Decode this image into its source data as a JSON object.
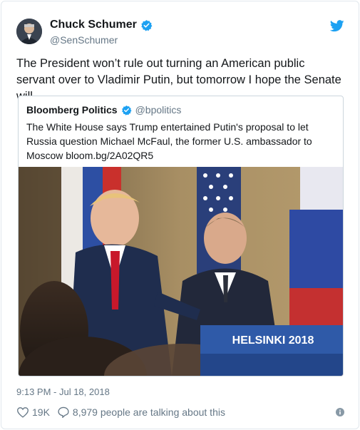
{
  "author": {
    "name": "Chuck Schumer",
    "handle": "@SenSchumer",
    "verified_icon": "verified-badge-icon"
  },
  "tweet": {
    "text": "The President won’t rule out turning an American public servant over to Vladimir Putin, but tomorrow I hope the Senate will.",
    "timestamp": "9:13 PM - Jul 18, 2018"
  },
  "quoted": {
    "name": "Bloomberg Politics",
    "handle": "@bpolitics",
    "text": "The White House says Trump entertained Putin's proposal to let Russia question Michael McFaul, the former U.S. ambassador to Moscow bloom.bg/2A02QR5",
    "image": {
      "podium_sign": "HELSINKI 2018"
    }
  },
  "actions": {
    "likes": "19K",
    "conversation": "8,979 people are talking about this"
  },
  "colors": {
    "brand_blue": "#1da1f2",
    "muted_text": "#657786",
    "border": "#e1e8ed"
  }
}
